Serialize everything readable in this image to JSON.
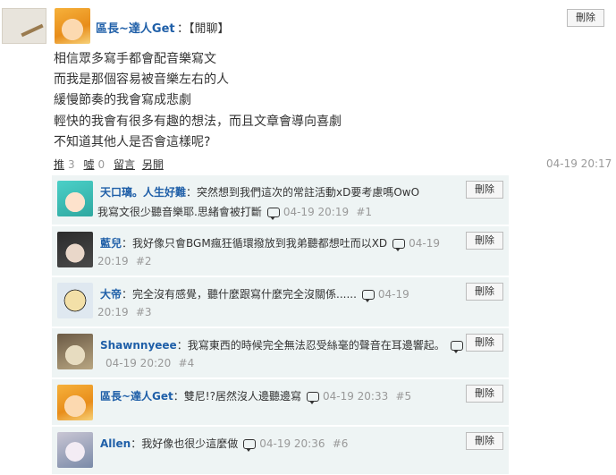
{
  "post": {
    "author": "區長~達人Get",
    "title": "：【閒聊】",
    "delete_label": "刪除",
    "lines": [
      "相信眾多寫手都會配音樂寫文",
      "而我是那個容易被音樂左右的人",
      "緩慢節奏的我會寫成悲劇",
      "輕快的我會有很多有趣的想法，而且文章會導向喜劇",
      "不知道其他人是否會這樣呢?"
    ],
    "actions": {
      "push_label": "推",
      "push_count": "3",
      "boo_label": "噓",
      "boo_count": "0",
      "reply_label": "留言",
      "share_label": "另開"
    },
    "time": "04-19 20:17"
  },
  "replies": [
    {
      "name": "天口璃。人生好難",
      "text": "：突然想到我們這次的常註活動xD要考慮嗎OwO",
      "text2": "我寫文很少聽音樂耶.思緒會被打斷",
      "time": "04-19 20:19",
      "floor": "#1",
      "delete_label": "刪除"
    },
    {
      "name": "藍兒",
      "text": "：我好像只會BGM瘋狂循環撥放到我弟聽都想吐而以XD",
      "time": "04-19",
      "time2": "20:19",
      "floor": "#2",
      "delete_label": "刪除"
    },
    {
      "name": "大帝",
      "text": "：完全沒有感覺，聽什麼跟寫什麼完全沒關係......",
      "time": "04-19",
      "time2": "20:19",
      "floor": "#3",
      "delete_label": "刪除"
    },
    {
      "name": "Shawnnyeee",
      "text": "：我寫東西的時候完全無法忍受絲毫的聲音在耳邊響起。",
      "time": "04-19 20:20",
      "floor": "#4",
      "delete_label": "刪除"
    },
    {
      "name": "區長~達人Get",
      "text": "：雙尼!?居然沒人邊聽邊寫",
      "time": "04-19 20:33",
      "floor": "#5",
      "delete_label": "刪除"
    },
    {
      "name": "Allen",
      "text": "：我好像也很少這麼做",
      "time": "04-19 20:36",
      "floor": "#6",
      "delete_label": "刪除"
    }
  ],
  "icons": {
    "reply_bubble": "speech-bubble-icon"
  }
}
